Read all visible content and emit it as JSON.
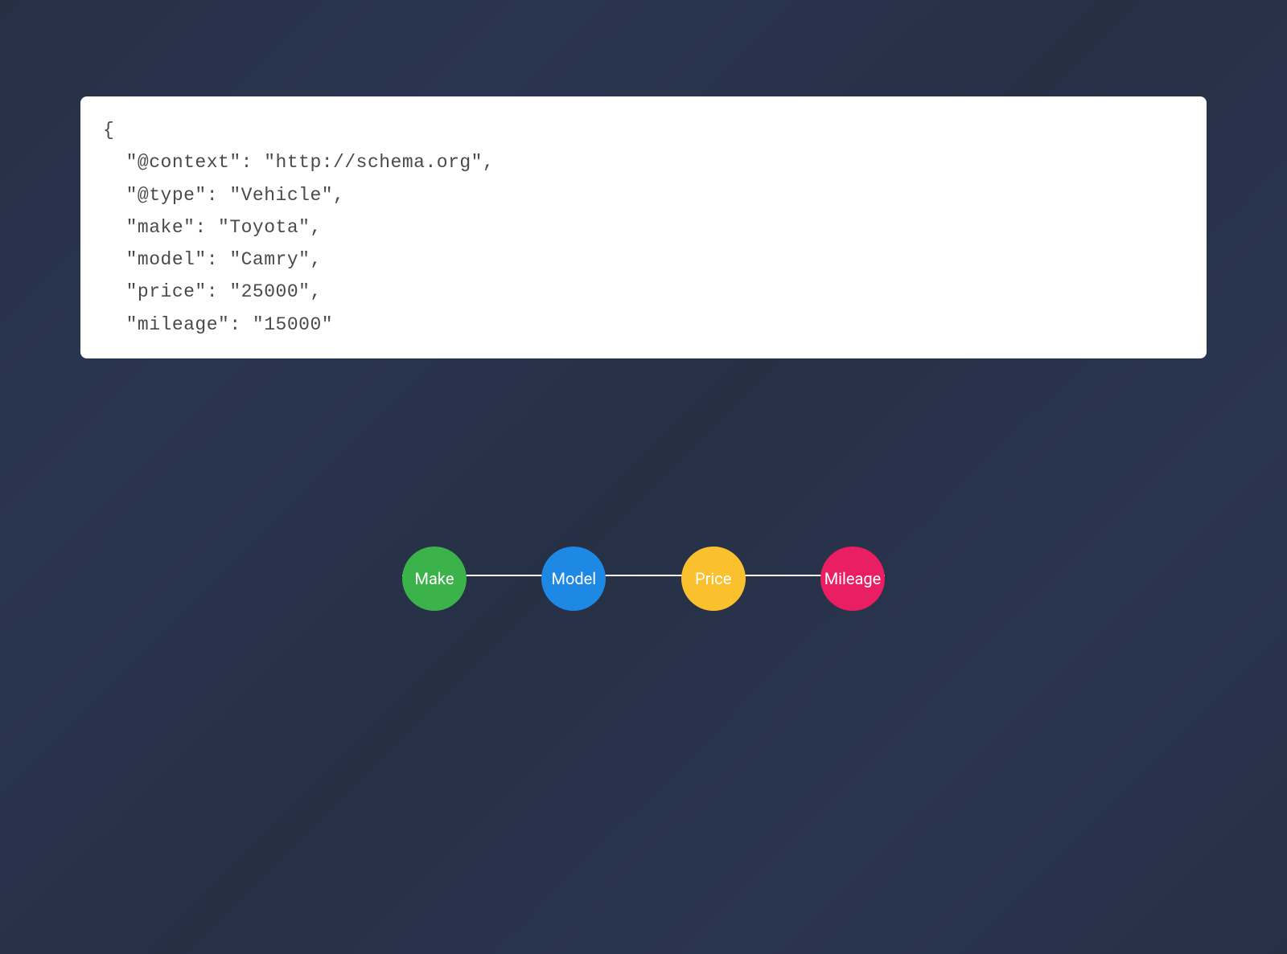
{
  "code": {
    "lines": [
      "{",
      "  \"@context\": \"http://schema.org\",",
      "  \"@type\": \"Vehicle\",",
      "  \"make\": \"Toyota\",",
      "  \"model\": \"Camry\",",
      "  \"price\": \"25000\",",
      "  \"mileage\": \"15000\""
    ]
  },
  "badges": [
    {
      "label": "Make",
      "color": "green"
    },
    {
      "label": "Model",
      "color": "blue"
    },
    {
      "label": "Price",
      "color": "yellow"
    },
    {
      "label": "Mileage",
      "color": "pink"
    }
  ]
}
